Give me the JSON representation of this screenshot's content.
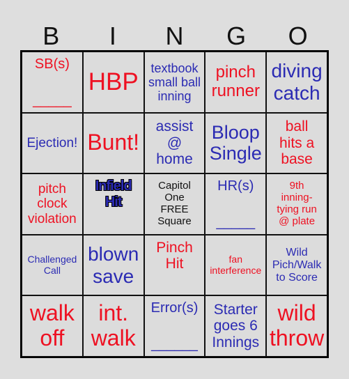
{
  "header": [
    "B",
    "I",
    "N",
    "G",
    "O"
  ],
  "colors": {
    "red": "#ee1122",
    "blue": "#2b2bb3",
    "black": "#111111"
  },
  "cells": [
    {
      "lines": [
        "SB(s)",
        "",
        "_____"
      ],
      "color": "red",
      "size": 20,
      "lh": 1.3
    },
    {
      "lines": [
        "HBP"
      ],
      "color": "red",
      "size": 35
    },
    {
      "lines": [
        "textbook",
        "small ball",
        "inning"
      ],
      "color": "blue",
      "size": 18
    },
    {
      "lines": [
        "pinch",
        "runner"
      ],
      "color": "red",
      "size": 24
    },
    {
      "lines": [
        "diving",
        "catch"
      ],
      "color": "blue",
      "size": 28
    },
    {
      "lines": [
        "Ejection!"
      ],
      "color": "blue",
      "size": 19
    },
    {
      "lines": [
        "Bunt!"
      ],
      "color": "red",
      "size": 32
    },
    {
      "lines": [
        "assist",
        "@",
        "home"
      ],
      "color": "blue",
      "size": 21
    },
    {
      "lines": [
        "Bloop",
        "Single"
      ],
      "color": "blue",
      "size": 27
    },
    {
      "lines": [
        "ball",
        "hits a",
        "base"
      ],
      "color": "red",
      "size": 21
    },
    {
      "lines": [
        "pitch",
        "clock",
        "violation"
      ],
      "color": "red",
      "size": 19
    },
    {
      "lines": [
        "Infield",
        "Hit"
      ],
      "color": "blue",
      "size": 20,
      "outlined": true,
      "valign": "top"
    },
    {
      "lines": [
        "Capitol",
        "One",
        "FREE",
        "Square"
      ],
      "color": "black",
      "size": 15
    },
    {
      "lines": [
        "HR(s)",
        "",
        "_____"
      ],
      "color": "blue",
      "size": 20,
      "lh": 1.3
    },
    {
      "lines": [
        "9th",
        "inning-",
        "tying run",
        "@ plate"
      ],
      "color": "red",
      "size": 15
    },
    {
      "lines": [
        "Challenged",
        "Call"
      ],
      "color": "blue",
      "size": 14
    },
    {
      "lines": [
        "blown",
        "save"
      ],
      "color": "blue",
      "size": 28
    },
    {
      "lines": [
        "Pinch",
        "Hit"
      ],
      "color": "red",
      "size": 21,
      "valign": "top"
    },
    {
      "lines": [
        "fan",
        "interference"
      ],
      "color": "red",
      "size": 14
    },
    {
      "lines": [
        "Wild",
        "Pich/Walk",
        "to Score"
      ],
      "color": "blue",
      "size": 16
    },
    {
      "lines": [
        "walk",
        "off"
      ],
      "color": "red",
      "size": 32
    },
    {
      "lines": [
        "int.",
        "walk"
      ],
      "color": "red",
      "size": 32
    },
    {
      "lines": [
        "Error(s)",
        "",
        "______"
      ],
      "color": "blue",
      "size": 20,
      "lh": 1.3
    },
    {
      "lines": [
        "Starter",
        "goes 6",
        "Innings"
      ],
      "color": "blue",
      "size": 21
    },
    {
      "lines": [
        "wild",
        "throw"
      ],
      "color": "red",
      "size": 32
    }
  ]
}
